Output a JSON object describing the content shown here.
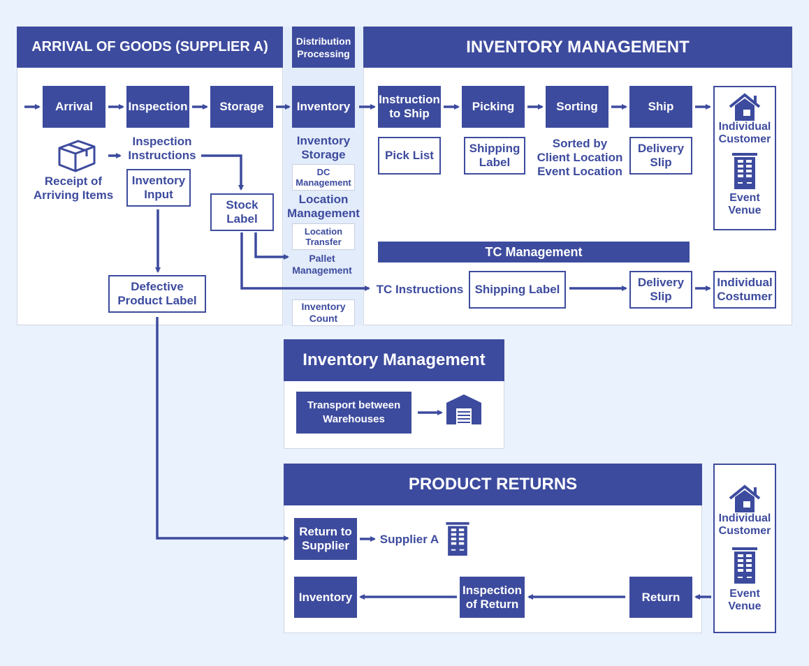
{
  "colors": {
    "primary": "#3d4b9e",
    "background": "#eaf2fd",
    "panel": "#ffffff"
  },
  "arrival": {
    "title": "ARRIVAL OF GOODS (SUPPLIER A)",
    "steps": [
      "Arrival",
      "Inspection",
      "Storage"
    ],
    "receipt_label": "Receipt of Arriving Items",
    "inspection_instructions": "Inspection Instructions",
    "inventory_input": "Inventory Input",
    "stock_label": "Stock Label",
    "defective_label": "Defective Product Label"
  },
  "distribution": {
    "title": "Distribution Processing",
    "inventory": "Inventory",
    "inventory_storage": "Inventory Storage",
    "dc_management": "DC Management",
    "location_management": "Location Management",
    "location_transfer": "Location Transfer",
    "pallet_management": "Pallet Management",
    "inventory_count": "Inventory Count"
  },
  "inventory_mgmt": {
    "title": "INVENTORY MANAGEMENT",
    "steps": [
      "Instruction to Ship",
      "Picking",
      "Sorting",
      "Ship"
    ],
    "pick_list": "Pick List",
    "shipping_label": "Shipping Label",
    "sorted_by": "Sorted by Client Location Event Location",
    "delivery_slip": "Delivery Slip",
    "individual_customer": "Individual Customer",
    "event_venue": "Event Venue",
    "tc": {
      "title": "TC Management",
      "instructions": "TC Instructions",
      "shipping_label": "Shipping Label",
      "delivery_slip": "Delivery Slip",
      "customer": "Individual Costumer"
    }
  },
  "inventory_mgmt2": {
    "title": "Inventory Management",
    "transport": "Transport between Warehouses"
  },
  "returns": {
    "title": "PRODUCT RETURNS",
    "return_to_supplier": "Return to Supplier",
    "supplier": "Supplier A",
    "inventory": "Inventory",
    "inspection_of_return": "Inspection of Return",
    "return": "Return",
    "individual_customer": "Individual Customer",
    "event_venue": "Event Venue"
  }
}
